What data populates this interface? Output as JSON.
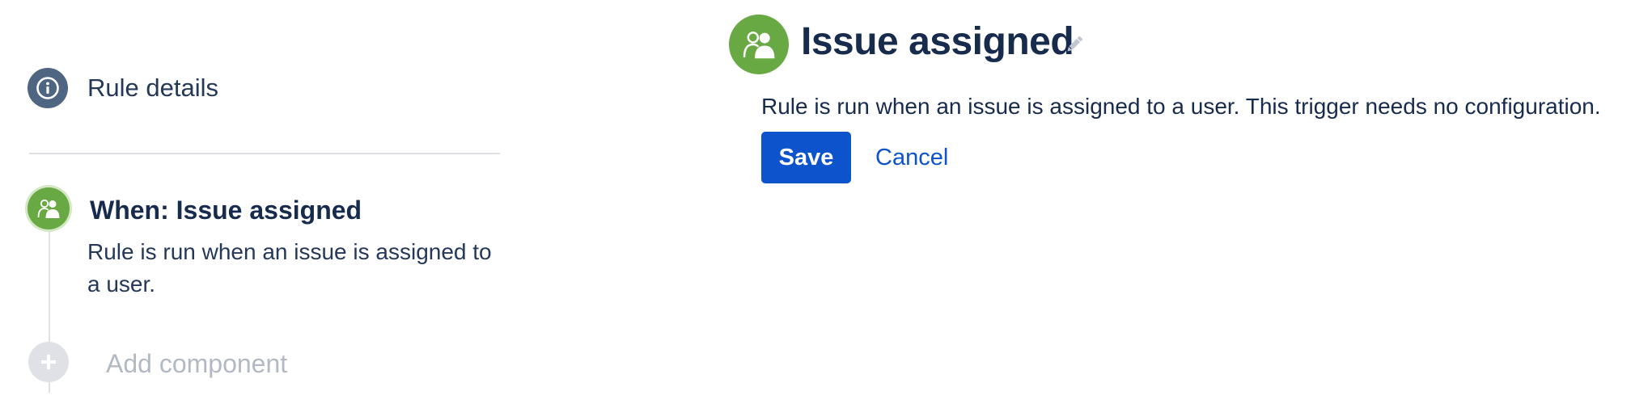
{
  "sidebar": {
    "rule_details": {
      "label": "Rule details",
      "icon": "info-icon"
    },
    "trigger": {
      "icon": "assign-user-icon",
      "title": "When: Issue assigned",
      "description": "Rule is run when an issue is assigned to a user."
    },
    "add_component": {
      "label": "Add component",
      "icon": "plus-icon"
    }
  },
  "main": {
    "icon": "assign-user-icon",
    "title": "Issue assigned",
    "edit_icon": "pencil-icon",
    "description": "Rule is run when an issue is assigned to a user. This trigger needs no configuration.",
    "save_label": "Save",
    "cancel_label": "Cancel"
  },
  "colors": {
    "trigger_green": "#69a943",
    "primary_blue": "#0c53cc",
    "info_slate": "#4f6683",
    "disabled_gray": "#dfe1e6"
  }
}
